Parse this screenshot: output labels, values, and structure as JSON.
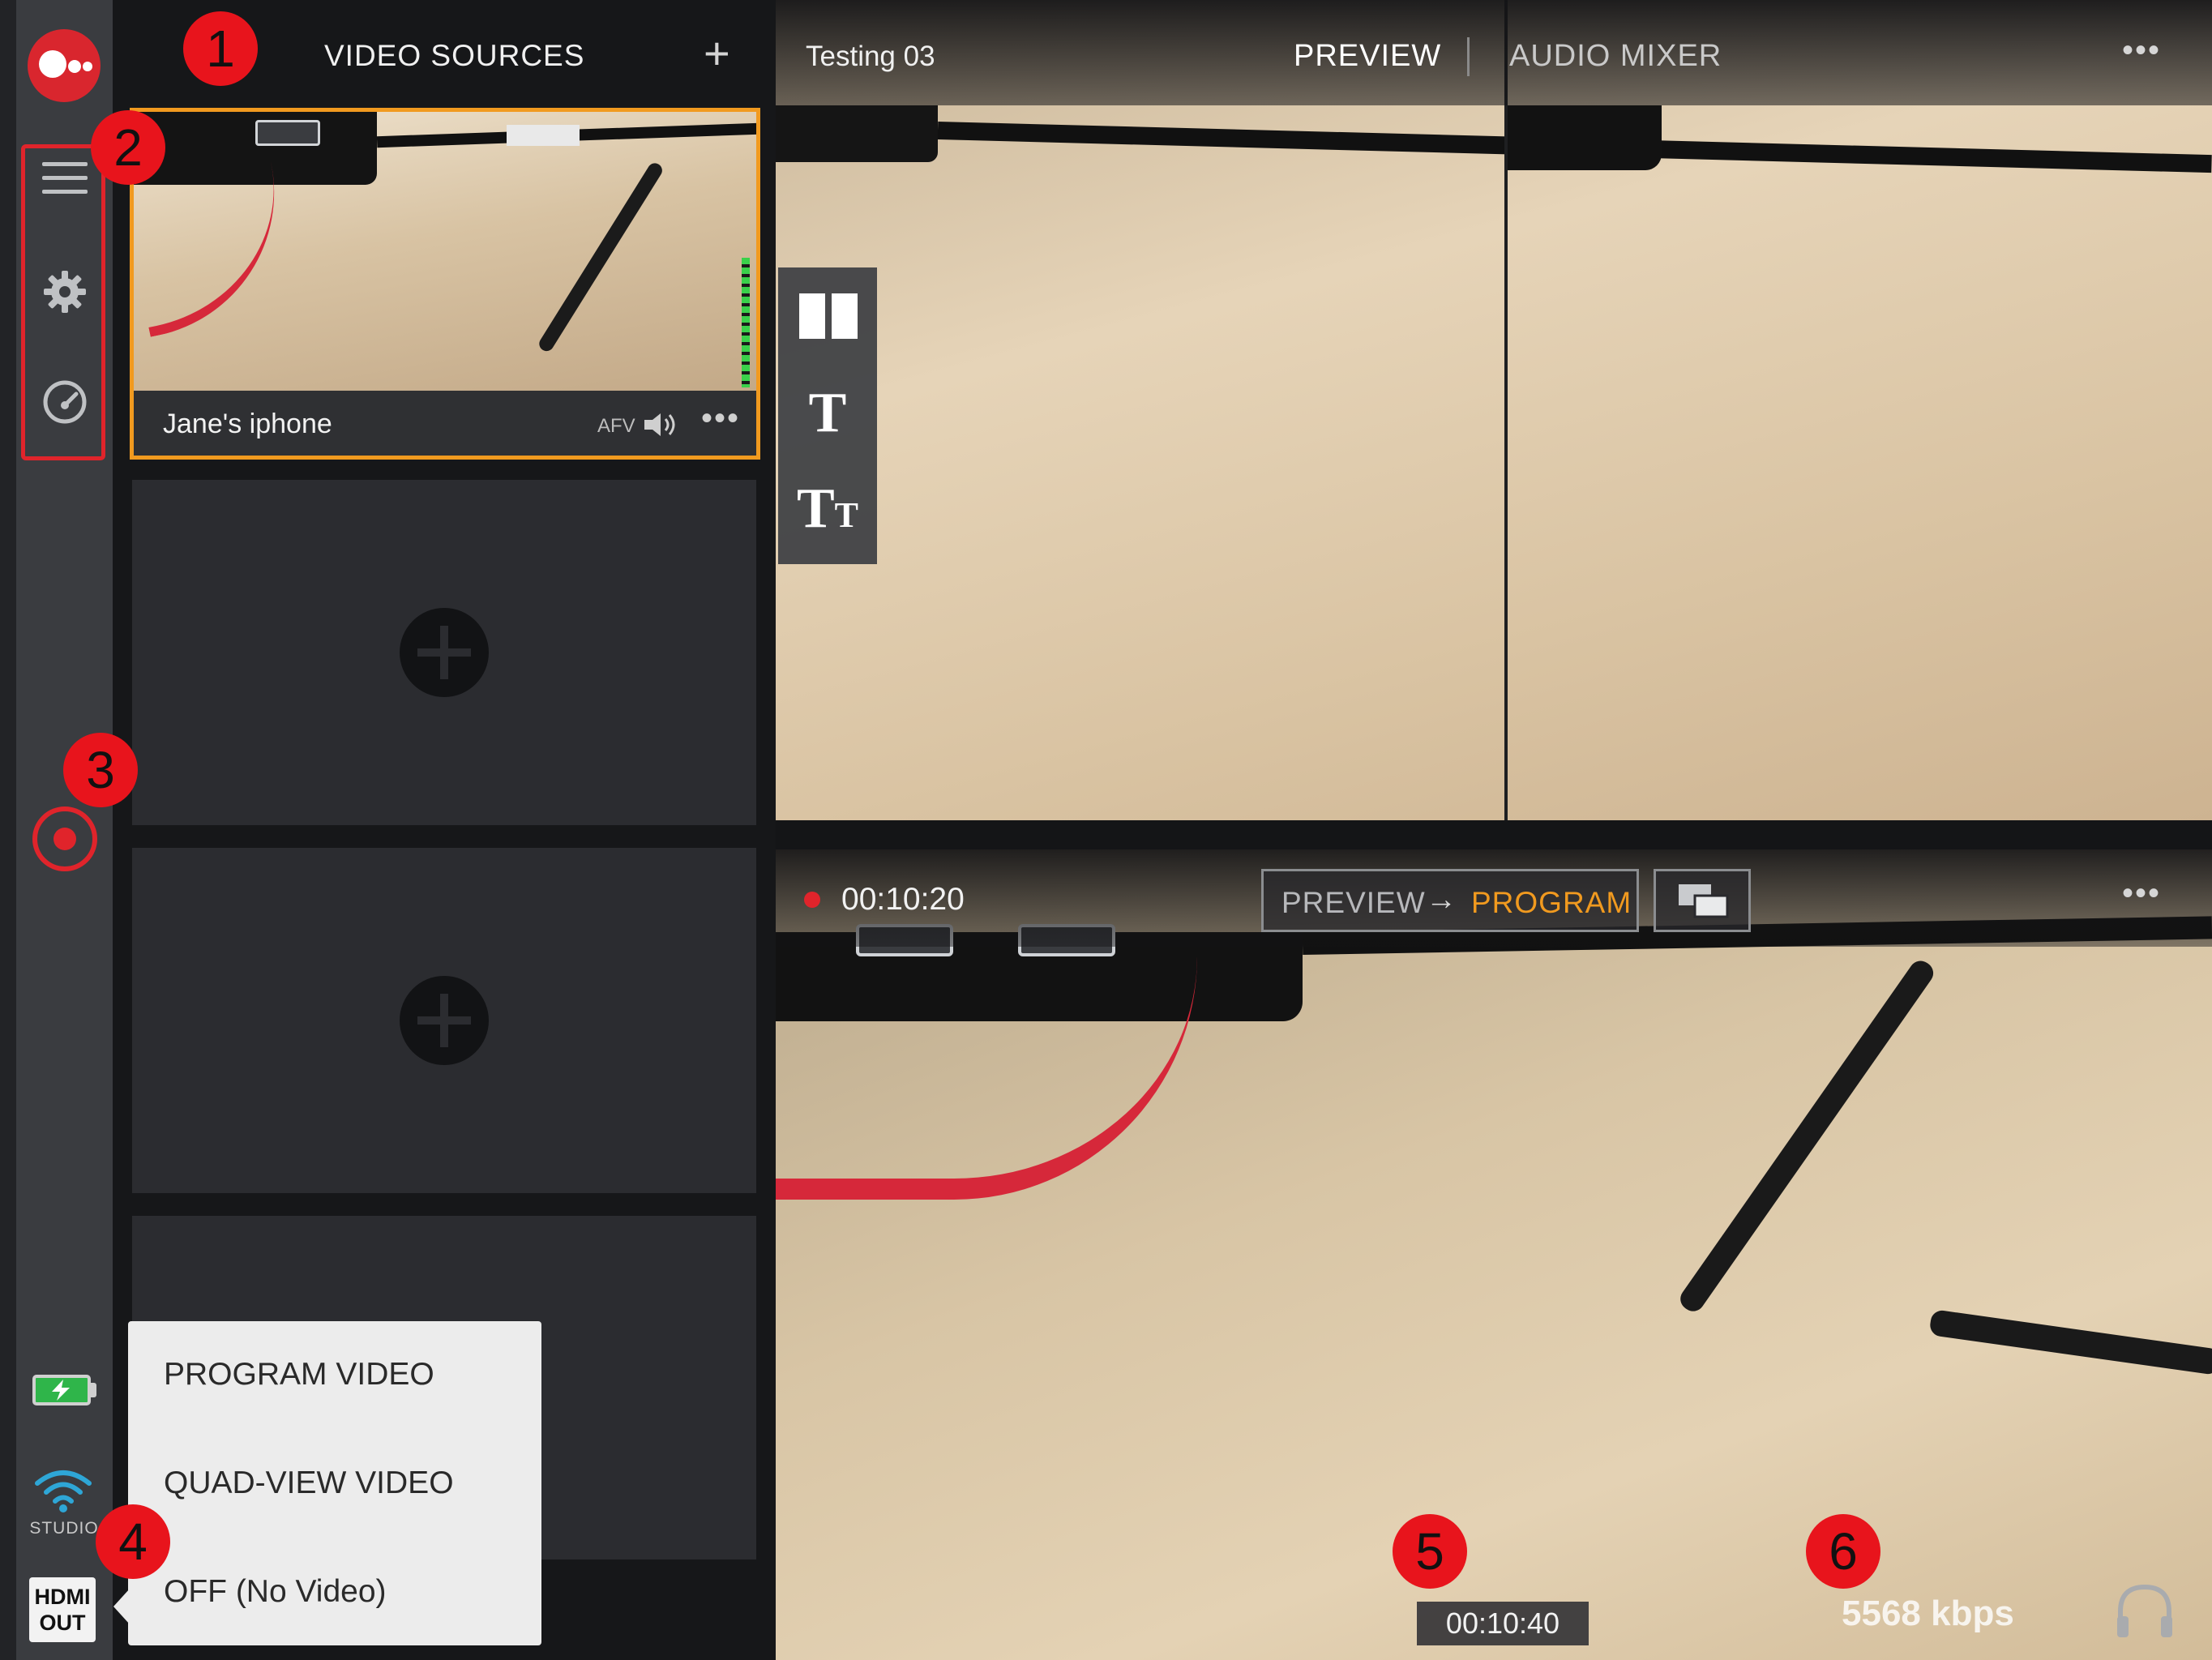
{
  "sidebar": {
    "studio_label": "STUDIO",
    "hdmi_label_line1": "HDMI",
    "hdmi_label_line2": "OUT"
  },
  "sources": {
    "title": "VIDEO SOURCES",
    "add_symbol": "+",
    "card": {
      "name": "Jane's iphone",
      "afv_label": "AFV",
      "more_symbol": "•••"
    }
  },
  "hdmi_menu": {
    "items": [
      "PROGRAM VIDEO",
      "QUAD-VIEW VIDEO",
      "OFF (No Video)"
    ]
  },
  "preview": {
    "title": "Testing 03",
    "tab_preview": "PREVIEW",
    "tab_audio_mixer": "AUDIO MIXER",
    "more_symbol": "•••",
    "title_tool_glyph": "T",
    "subtitle_tool_glyph_big": "T",
    "subtitle_tool_glyph_small": "T"
  },
  "program": {
    "record_time": "00:10:20",
    "transition_from": "PREVIEW",
    "transition_arrow": "→",
    "transition_to": "PROGRAM",
    "more_symbol": "•••",
    "timecode": "00:10:40",
    "bitrate": "5568 kbps"
  },
  "markers": [
    "1",
    "2",
    "3",
    "4",
    "5",
    "6"
  ],
  "colors": {
    "accent_orange": "#f19a1f",
    "record_red": "#e0242b",
    "marker_red": "#e8141c",
    "battery_green": "#2fb54a"
  },
  "icons": {
    "logo": "brand-logo-icon",
    "menu": "hamburger-menu-icon",
    "settings": "gear-icon",
    "dashboard": "gauge-icon",
    "record": "record-icon",
    "battery": "battery-charging-icon",
    "wifi": "wifi-icon",
    "audio": "speaker-icon",
    "layout": "split-layout-icon",
    "title": "title-text-icon",
    "subtitle": "lower-third-text-icon",
    "swap": "swap-screens-icon",
    "headphone": "headphone-icon",
    "add_source": "plus-circle-icon"
  }
}
